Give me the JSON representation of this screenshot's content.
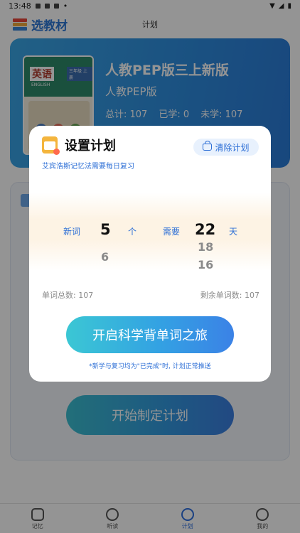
{
  "status_bar": {
    "time": "13:48"
  },
  "header": {
    "select_textbook": "选教材",
    "page_title": "计划"
  },
  "book": {
    "cover_title": "英语",
    "cover_subtitle": "ENGLISH",
    "cover_grade": "三年级 上册",
    "name": "人教PEP版三上新版",
    "edition": "人教PEP版",
    "total_label": "总计: 107",
    "learned_label": "已学: 0",
    "unlearned_label": "未学: 107"
  },
  "main": {
    "start_plan_label": "开始制定计划"
  },
  "modal": {
    "title": "设置计划",
    "clear_label": "清除计划",
    "subtitle": "艾宾浩斯记忆法需要每日复习",
    "picker": {
      "new_words_label": "新词",
      "new_words_value": "5",
      "new_words_next": "6",
      "new_words_unit": "个",
      "needs_label": "需要",
      "days_value": "22",
      "days_below_1": "18",
      "days_below_2": "16",
      "days_unit": "天"
    },
    "total_words": "单词总数: 107",
    "remaining_words": "剩余单词数: 107",
    "start_journey_label": "开启科学背单词之旅",
    "note": "*新学与复习均为\"已完成\"时, 计划正常推送"
  },
  "tabs": [
    {
      "label": "记忆",
      "icon": "memory-icon",
      "active": false
    },
    {
      "label": "听读",
      "icon": "listen-read-icon",
      "active": false
    },
    {
      "label": "计划",
      "icon": "plan-icon",
      "active": true
    },
    {
      "label": "我的",
      "icon": "profile-icon",
      "active": false
    }
  ],
  "colors": {
    "accent": "#2d6fd6",
    "button_start": "#3bc7d4",
    "button_end": "#3b82e6",
    "card_blue": "#2f8fe0",
    "calendar_orange": "#f4b53d"
  }
}
